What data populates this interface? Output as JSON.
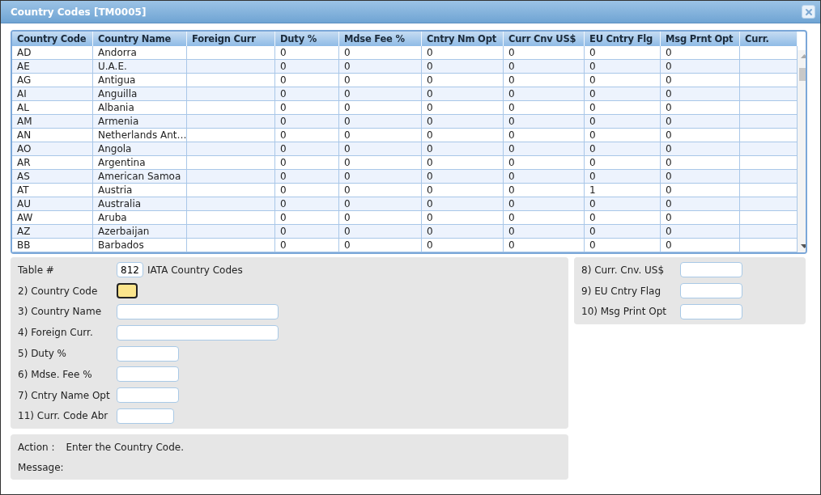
{
  "window": {
    "title": "Country Codes [TM0005]"
  },
  "table": {
    "columns": [
      "Country Code",
      "Country Name",
      "Foreign Curr",
      "Duty %",
      "Mdse Fee %",
      "Cntry Nm Opt",
      "Curr Cnv US$",
      "EU Cntry Flg",
      "Msg Prnt Opt",
      "Curr."
    ],
    "rows": [
      {
        "code": "AD",
        "name": "Andorra",
        "duty": "0",
        "mdse": "0",
        "nm_opt": "0",
        "cnv": "0",
        "eu": "0",
        "msg": "0"
      },
      {
        "code": "AE",
        "name": "U.A.E.",
        "duty": "0",
        "mdse": "0",
        "nm_opt": "0",
        "cnv": "0",
        "eu": "0",
        "msg": "0"
      },
      {
        "code": "AG",
        "name": "Antigua",
        "duty": "0",
        "mdse": "0",
        "nm_opt": "0",
        "cnv": "0",
        "eu": "0",
        "msg": "0"
      },
      {
        "code": "AI",
        "name": "Anguilla",
        "duty": "0",
        "mdse": "0",
        "nm_opt": "0",
        "cnv": "0",
        "eu": "0",
        "msg": "0"
      },
      {
        "code": "AL",
        "name": "Albania",
        "duty": "0",
        "mdse": "0",
        "nm_opt": "0",
        "cnv": "0",
        "eu": "0",
        "msg": "0"
      },
      {
        "code": "AM",
        "name": "Armenia",
        "duty": "0",
        "mdse": "0",
        "nm_opt": "0",
        "cnv": "0",
        "eu": "0",
        "msg": "0"
      },
      {
        "code": "AN",
        "name": "Netherlands Ant…",
        "duty": "0",
        "mdse": "0",
        "nm_opt": "0",
        "cnv": "0",
        "eu": "0",
        "msg": "0"
      },
      {
        "code": "AO",
        "name": "Angola",
        "duty": "0",
        "mdse": "0",
        "nm_opt": "0",
        "cnv": "0",
        "eu": "0",
        "msg": "0"
      },
      {
        "code": "AR",
        "name": "Argentina",
        "duty": "0",
        "mdse": "0",
        "nm_opt": "0",
        "cnv": "0",
        "eu": "0",
        "msg": "0"
      },
      {
        "code": "AS",
        "name": "American Samoa",
        "duty": "0",
        "mdse": "0",
        "nm_opt": "0",
        "cnv": "0",
        "eu": "0",
        "msg": "0"
      },
      {
        "code": "AT",
        "name": "Austria",
        "duty": "0",
        "mdse": "0",
        "nm_opt": "0",
        "cnv": "0",
        "eu": "1",
        "msg": "0"
      },
      {
        "code": "AU",
        "name": "Australia",
        "duty": "0",
        "mdse": "0",
        "nm_opt": "0",
        "cnv": "0",
        "eu": "0",
        "msg": "0"
      },
      {
        "code": "AW",
        "name": "Aruba",
        "duty": "0",
        "mdse": "0",
        "nm_opt": "0",
        "cnv": "0",
        "eu": "0",
        "msg": "0"
      },
      {
        "code": "AZ",
        "name": "Azerbaijan",
        "duty": "0",
        "mdse": "0",
        "nm_opt": "0",
        "cnv": "0",
        "eu": "0",
        "msg": "0"
      },
      {
        "code": "BB",
        "name": "Barbados",
        "duty": "0",
        "mdse": "0",
        "nm_opt": "0",
        "cnv": "0",
        "eu": "0",
        "msg": "0"
      }
    ]
  },
  "form": {
    "table_number": {
      "label": "Table #",
      "value": "812",
      "description": "IATA Country Codes"
    },
    "left_fields": [
      {
        "label": "2) Country Code",
        "kind": "code",
        "focused": true
      },
      {
        "label": "3) Country Name",
        "kind": "wide",
        "focused": false
      },
      {
        "label": "4) Foreign Curr.",
        "kind": "wide",
        "focused": false
      },
      {
        "label": "5) Duty %",
        "kind": "narrow",
        "focused": false
      },
      {
        "label": "6) Mdse. Fee %",
        "kind": "narrow",
        "focused": false
      },
      {
        "label": "7) Cntry Name Opt",
        "kind": "narrow",
        "focused": false
      },
      {
        "label": "11) Curr. Code Abr",
        "kind": "small",
        "focused": false
      }
    ],
    "right_fields": [
      {
        "label": "8) Curr. Cnv. US$",
        "kind": "narrow",
        "focused": false
      },
      {
        "label": "9) EU Cntry Flag",
        "kind": "narrow",
        "focused": false
      },
      {
        "label": "10) Msg Print Opt",
        "kind": "narrow",
        "focused": false
      }
    ]
  },
  "status": {
    "action_label": "Action :",
    "action": "Enter the Country Code.",
    "message_label": "Message:"
  }
}
